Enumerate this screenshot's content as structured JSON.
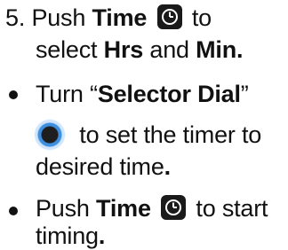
{
  "steps": [
    {
      "number": "5.",
      "line1": {
        "t1": "Push ",
        "b1": "Time",
        "t2": " to"
      },
      "line2": {
        "t1": "select ",
        "b1": "Hrs",
        "t2": " and ",
        "b2": "Min",
        "t3": "."
      }
    }
  ],
  "bullet1": {
    "line1": {
      "t1": "Turn “",
      "b1": "Selector Dial",
      "t2": "”"
    },
    "line2": {
      "t1": " to set the timer to"
    },
    "line3": {
      "t1": "desired time",
      "b1": "."
    }
  },
  "bullet2": {
    "line1": {
      "t1": "Push ",
      "b1": "Time",
      "t2": " to start"
    },
    "line2": {
      "t1": "timing",
      "b1": "."
    }
  },
  "icons": {
    "time_button": "clock-icon",
    "selector_dial": "dial-icon"
  }
}
